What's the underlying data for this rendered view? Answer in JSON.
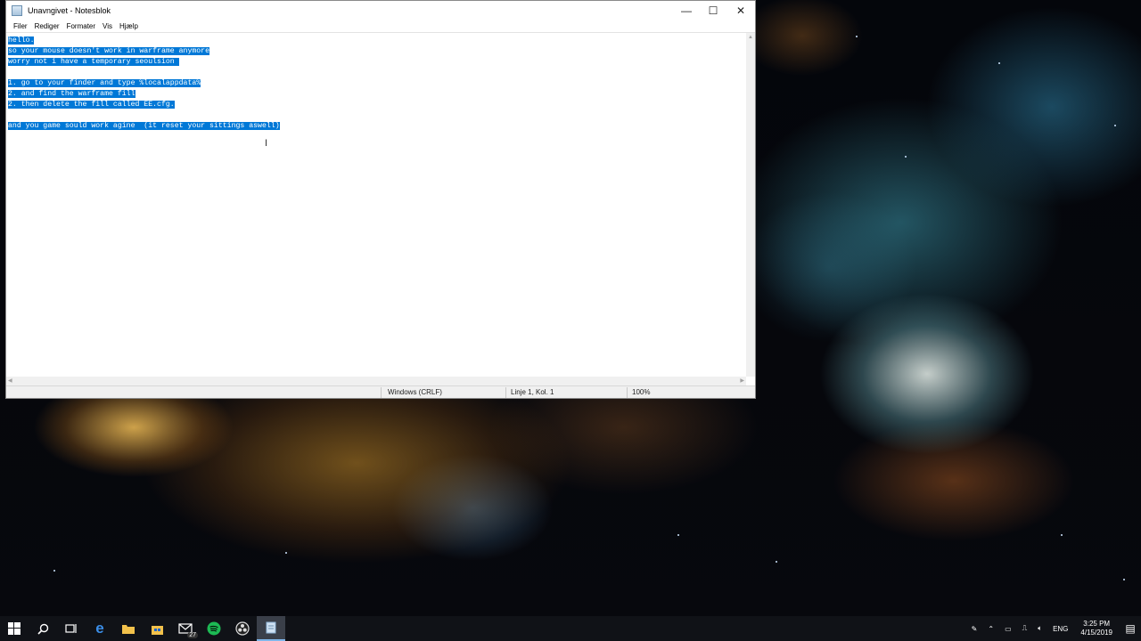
{
  "window": {
    "title": "Unavngivet - Notesblok",
    "controls": {
      "minimize": "—",
      "maximize": "☐",
      "close": "✕"
    }
  },
  "menu": [
    "Filer",
    "Rediger",
    "Formater",
    "Vis",
    "Hjælp"
  ],
  "editor": {
    "lines": [
      "hello.",
      "so your mouse doesn't work in warframe anymore",
      "worry not i have a temporary seoulsion ",
      "",
      "1. go to your finder and type %localappdata%",
      "2. and find the warframe fill",
      "2. then delete the fill called EE.cfg.",
      "",
      "and you game sould work agine  (it reset your sittings aswell)"
    ],
    "selection_color": "#0078d7"
  },
  "status": {
    "encoding": "Windows (CRLF)",
    "position": "Linje 1, Kol. 1",
    "zoom": "100%"
  },
  "taskbar": {
    "icons": [
      "windows-start-icon",
      "search-icon",
      "task-view-icon",
      "edge-icon",
      "file-explorer-icon",
      "store-icon",
      "mail-icon",
      "spotify-icon",
      "obs-icon",
      "notepad-icon"
    ],
    "mail_badge": "27",
    "tray": {
      "language": "ENG",
      "time": "3:25 PM",
      "date": "4/15/2019"
    }
  }
}
